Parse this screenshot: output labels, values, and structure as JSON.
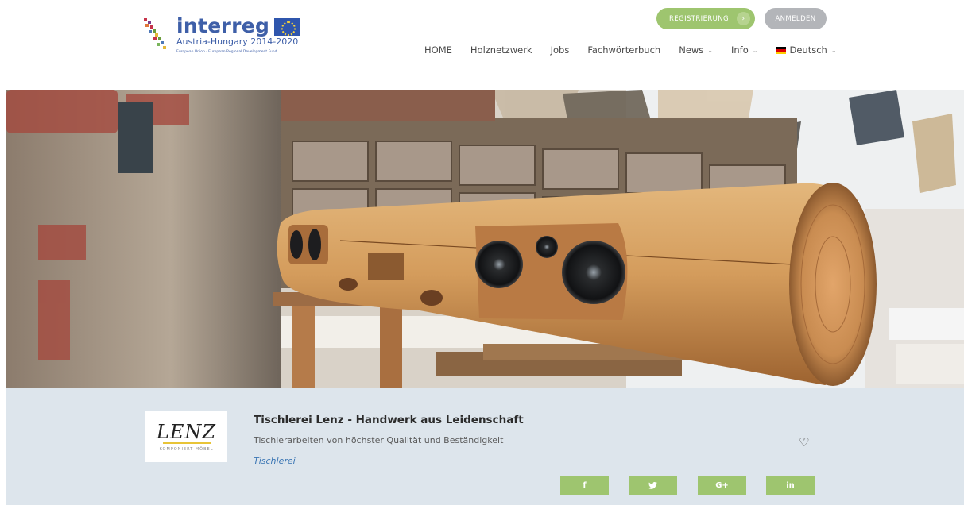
{
  "header": {
    "logo": {
      "word": "interreg",
      "subtitle": "Austria-Hungary 2014-2020",
      "tagline": "European Union · European Regional Development Fund"
    },
    "register_label": "REGISTRIERUNG",
    "register_arrow": "›",
    "login_label": "ANMELDEN"
  },
  "nav": {
    "items": [
      {
        "label": "HOME"
      },
      {
        "label": "Holznetzwerk"
      },
      {
        "label": "Jobs"
      },
      {
        "label": "Fachwörterbuch"
      },
      {
        "label": "News"
      },
      {
        "label": "Info"
      },
      {
        "label": "Deutsch"
      }
    ],
    "caret": "⌄"
  },
  "company": {
    "logo_brand": "LENZ",
    "logo_sub": "KOMPONIERT MÖBEL",
    "name": "Tischlerei Lenz - Handwerk aus Leidenschaft",
    "description": "Tischlerarbeiten von höchster Qualität und Beständigkeit",
    "category": "Tischlerei",
    "favorite_icon": "heart-outline-icon"
  },
  "social": {
    "facebook": "f",
    "twitter": "🐦",
    "google_plus": "G+",
    "linkedin": "in"
  },
  "colors": {
    "accent_green": "#9ec56f",
    "login_gray": "#b3b5b9",
    "brand_blue": "#3e5fa8",
    "company_bar": "#dde5ec",
    "category_link": "#3b76b4"
  }
}
